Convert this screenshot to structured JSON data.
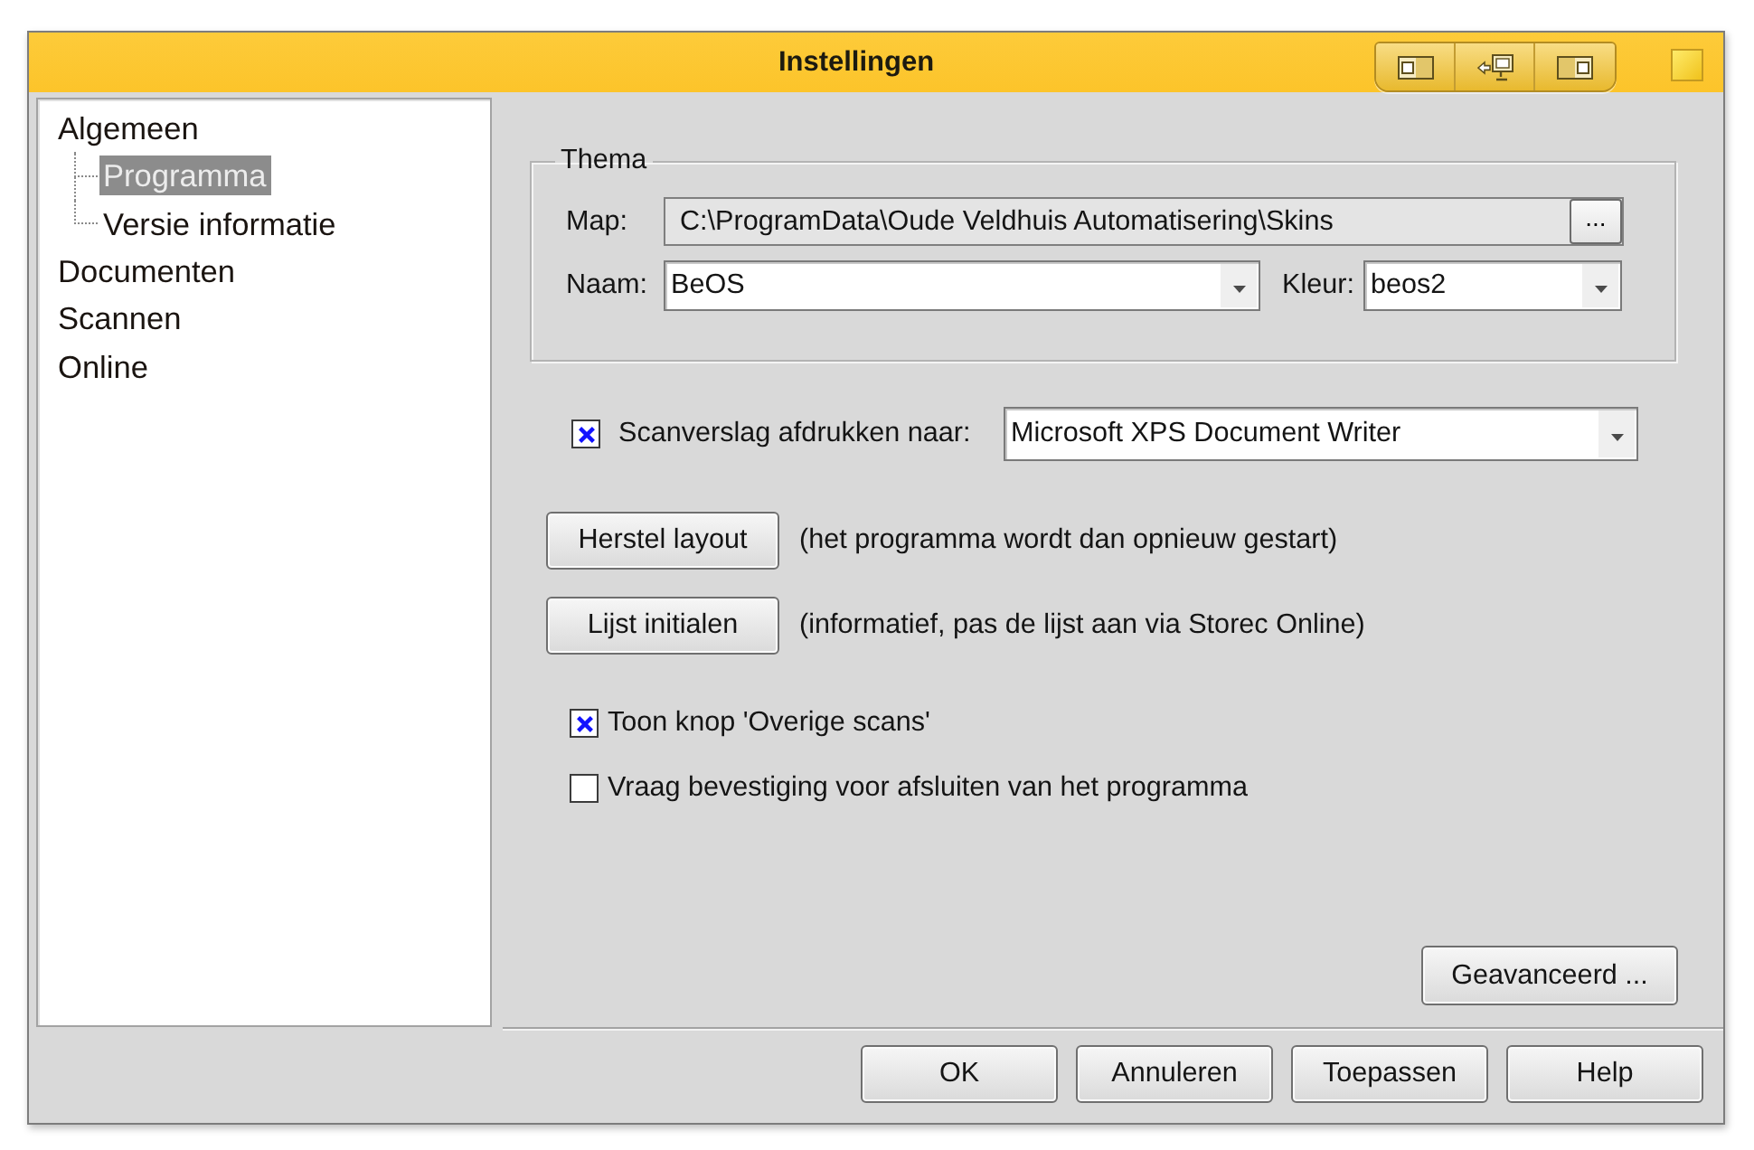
{
  "window": {
    "title": "Instellingen"
  },
  "sidebar": {
    "items": [
      {
        "label": "Algemeen",
        "selected": false,
        "children": [
          {
            "label": "Programma",
            "selected": true
          },
          {
            "label": "Versie informatie",
            "selected": false
          }
        ]
      },
      {
        "label": "Documenten",
        "selected": false
      },
      {
        "label": "Scannen",
        "selected": false
      },
      {
        "label": "Online",
        "selected": false
      }
    ]
  },
  "theme_group": {
    "legend": "Thema",
    "folder": {
      "label": "Map:",
      "value": "C:\\ProgramData\\Oude Veldhuis Automatisering\\Skins",
      "browse_button": "..."
    },
    "skin": {
      "label": "Naam:",
      "value": "BeOS"
    },
    "palette": {
      "label": "Kleur:",
      "value": "beos2"
    }
  },
  "scan_report": {
    "label": "Scanverslag afdrukken naar:",
    "checked": true,
    "printer": "Microsoft XPS Document Writer"
  },
  "actions": [
    {
      "button": "Herstel layout",
      "note": "(het programma wordt dan opnieuw gestart)"
    },
    {
      "button": "Lijst initialen",
      "note": "(informatief, pas de lijst aan via Storec Online)"
    }
  ],
  "options": [
    {
      "label": "Toon knop 'Overige scans'",
      "checked": true
    },
    {
      "label": "Vraag bevestiging voor afsluiten van het programma",
      "checked": false
    }
  ],
  "advanced_button": "Geavanceerd ...",
  "dialog_buttons": [
    "OK",
    "Annuleren",
    "Toepassen",
    "Help"
  ]
}
